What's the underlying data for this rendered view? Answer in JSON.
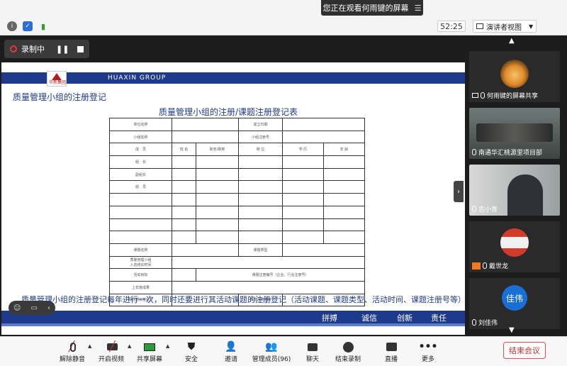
{
  "topbar": {
    "banner_text": "您正在观看何雨键的屏幕",
    "banner_menu_icon": "menu-icon",
    "timer": "52:25",
    "view_selector": "演讲者视图"
  },
  "recording": {
    "label": "录制中"
  },
  "slide": {
    "header": "HUAXIN GROUP",
    "logo_text": "华新集团",
    "section_title": "质量管理小组的注册登记",
    "table_title": "质量管理小组的注册/课题注册登记表",
    "table": {
      "r0c0": "单位名称",
      "r0c3": "成立日期",
      "r1c0": "小组名称",
      "r1c3": "小组注册号",
      "r2": [
        "成　员",
        "姓 名",
        "职务/职称",
        "岗 位",
        "学 历",
        "年 龄"
      ],
      "r3c0": "组　长",
      "r4c0": "副组长",
      "r5c0": "组　员",
      "r10c0": "课题名称",
      "r10c3": "课题类型",
      "r11c0": "质量管理小组\n入选培训时间",
      "r12c0": "活动目标",
      "r12c2": "课题注册编号（企业、行业注册号）",
      "r13c0": "上年度成果",
      "r14c0": "现任部长签名人",
      "r14c3": "课题注册时间"
    },
    "note": "质量管理小组的注册登记每年进行一次，同时还要进行其活动课题的注册登记（活动课题、课题类型、活动时间、课题注册号等）",
    "motto": [
      "拼搏",
      "诚信",
      "创新",
      "责任"
    ]
  },
  "participants": [
    {
      "name": "何雨键的屏幕共享",
      "tile": "avatar-orange"
    },
    {
      "name": "南通华汇桃源里项目部",
      "tile": "meeting-room"
    },
    {
      "name": "吉小青",
      "tile": "person"
    },
    {
      "name": "戴世龙",
      "tile": "avatar-flag"
    },
    {
      "name": "刘佳伟",
      "avatar_text": "佳伟",
      "tile": "avatar-blue"
    }
  ],
  "toolbar": {
    "items": [
      {
        "label": "解除静音",
        "icon": "mic-muted-icon"
      },
      {
        "label": "开启视频",
        "icon": "camera-off-icon"
      },
      {
        "label": "共享屏幕",
        "icon": "share-screen-icon"
      },
      {
        "label": "安全",
        "icon": "shield-icon"
      },
      {
        "label": "邀请",
        "icon": "invite-icon"
      },
      {
        "label": "管理成员(96)",
        "icon": "members-icon"
      },
      {
        "label": "聊天",
        "icon": "chat-icon"
      },
      {
        "label": "结束录制",
        "icon": "stop-record-icon"
      },
      {
        "label": "直播",
        "icon": "live-icon"
      },
      {
        "label": "更多",
        "icon": "more-icon"
      }
    ],
    "end_meeting": "结束会议"
  },
  "colors": {
    "slide_accent": "#1e3a8a",
    "end_button": "#d03030",
    "recording_dot": "#e53935"
  }
}
